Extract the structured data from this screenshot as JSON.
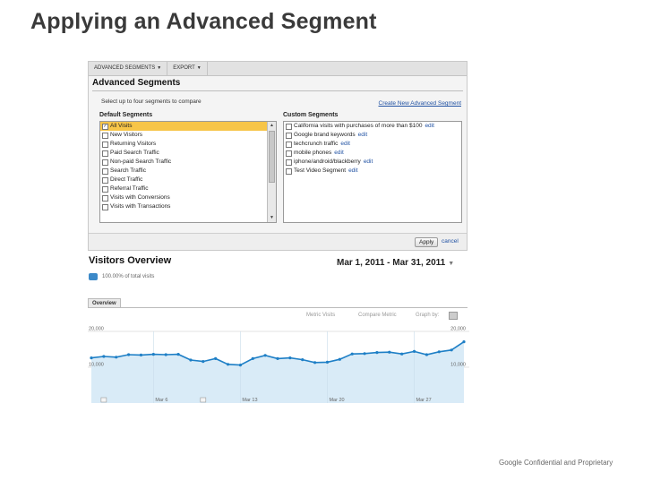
{
  "slide": {
    "title": "Applying an Advanced Segment",
    "footer": "Google Confidential and Proprietary"
  },
  "toolbar": {
    "advanced_segments": "ADVANCED SEGMENTS",
    "export": "EXPORT"
  },
  "segments_panel": {
    "heading": "Advanced Segments",
    "instruction": "Select up to four segments to compare",
    "create_link": "Create New Advanced Segment",
    "default_heading": "Default Segments",
    "custom_heading": "Custom Segments",
    "default_items": [
      {
        "label": "All Visits",
        "checked": true,
        "selected": true
      },
      {
        "label": "New Visitors",
        "checked": false,
        "selected": false
      },
      {
        "label": "Returning Visitors",
        "checked": false,
        "selected": false
      },
      {
        "label": "Paid Search Traffic",
        "checked": false,
        "selected": false
      },
      {
        "label": "Non-paid Search Traffic",
        "checked": false,
        "selected": false
      },
      {
        "label": "Search Traffic",
        "checked": false,
        "selected": false
      },
      {
        "label": "Direct Traffic",
        "checked": false,
        "selected": false
      },
      {
        "label": "Referral Traffic",
        "checked": false,
        "selected": false
      },
      {
        "label": "Visits with Conversions",
        "checked": false,
        "selected": false
      },
      {
        "label": "Visits with Transactions",
        "checked": false,
        "selected": false
      }
    ],
    "custom_items": [
      {
        "label": "California visits with purchases of more than $100",
        "edit": "edit"
      },
      {
        "label": "Google brand keywords",
        "edit": "edit"
      },
      {
        "label": "techcrunch traffic",
        "edit": "edit"
      },
      {
        "label": "mobile phones",
        "edit": "edit"
      },
      {
        "label": "iphone/android/blackberry",
        "edit": "edit"
      },
      {
        "label": "Test Video Segment",
        "edit": "edit"
      }
    ],
    "apply": "Apply",
    "cancel": "cancel"
  },
  "overview": {
    "title": "Visitors Overview",
    "date_range": "Mar 1, 2011 - Mar 31, 2011",
    "pct_of_total": "100.00% of total visits",
    "tab": "Overview",
    "metric_visits": "Metric Visits",
    "compare_metric": "Compare Metric",
    "graph_by": "Graph by:"
  },
  "colors": {
    "line": "#1e7fc6",
    "fill": "#d9ebf7",
    "selected_row": "#f7c548",
    "link": "#2152a3"
  },
  "chart_data": {
    "type": "area",
    "ylabels": [
      "20,000",
      "10,000"
    ],
    "ylim": [
      0,
      20000
    ],
    "x_ticks": [
      "Mar 6",
      "Mar 13",
      "Mar 20",
      "Mar 27"
    ],
    "x": [
      1,
      2,
      3,
      4,
      5,
      6,
      7,
      8,
      9,
      10,
      11,
      12,
      13,
      14,
      15,
      16,
      17,
      18,
      19,
      20,
      21,
      22,
      23,
      24,
      25,
      26,
      27,
      28,
      29,
      30,
      31
    ],
    "values": [
      12600,
      13000,
      12800,
      13500,
      13400,
      13600,
      13500,
      13600,
      12000,
      11600,
      12400,
      10800,
      10600,
      12400,
      13300,
      12400,
      12600,
      12100,
      11300,
      11400,
      12200,
      13700,
      13800,
      14100,
      14200,
      13700,
      14400,
      13500,
      14300,
      14800,
      17100
    ]
  }
}
